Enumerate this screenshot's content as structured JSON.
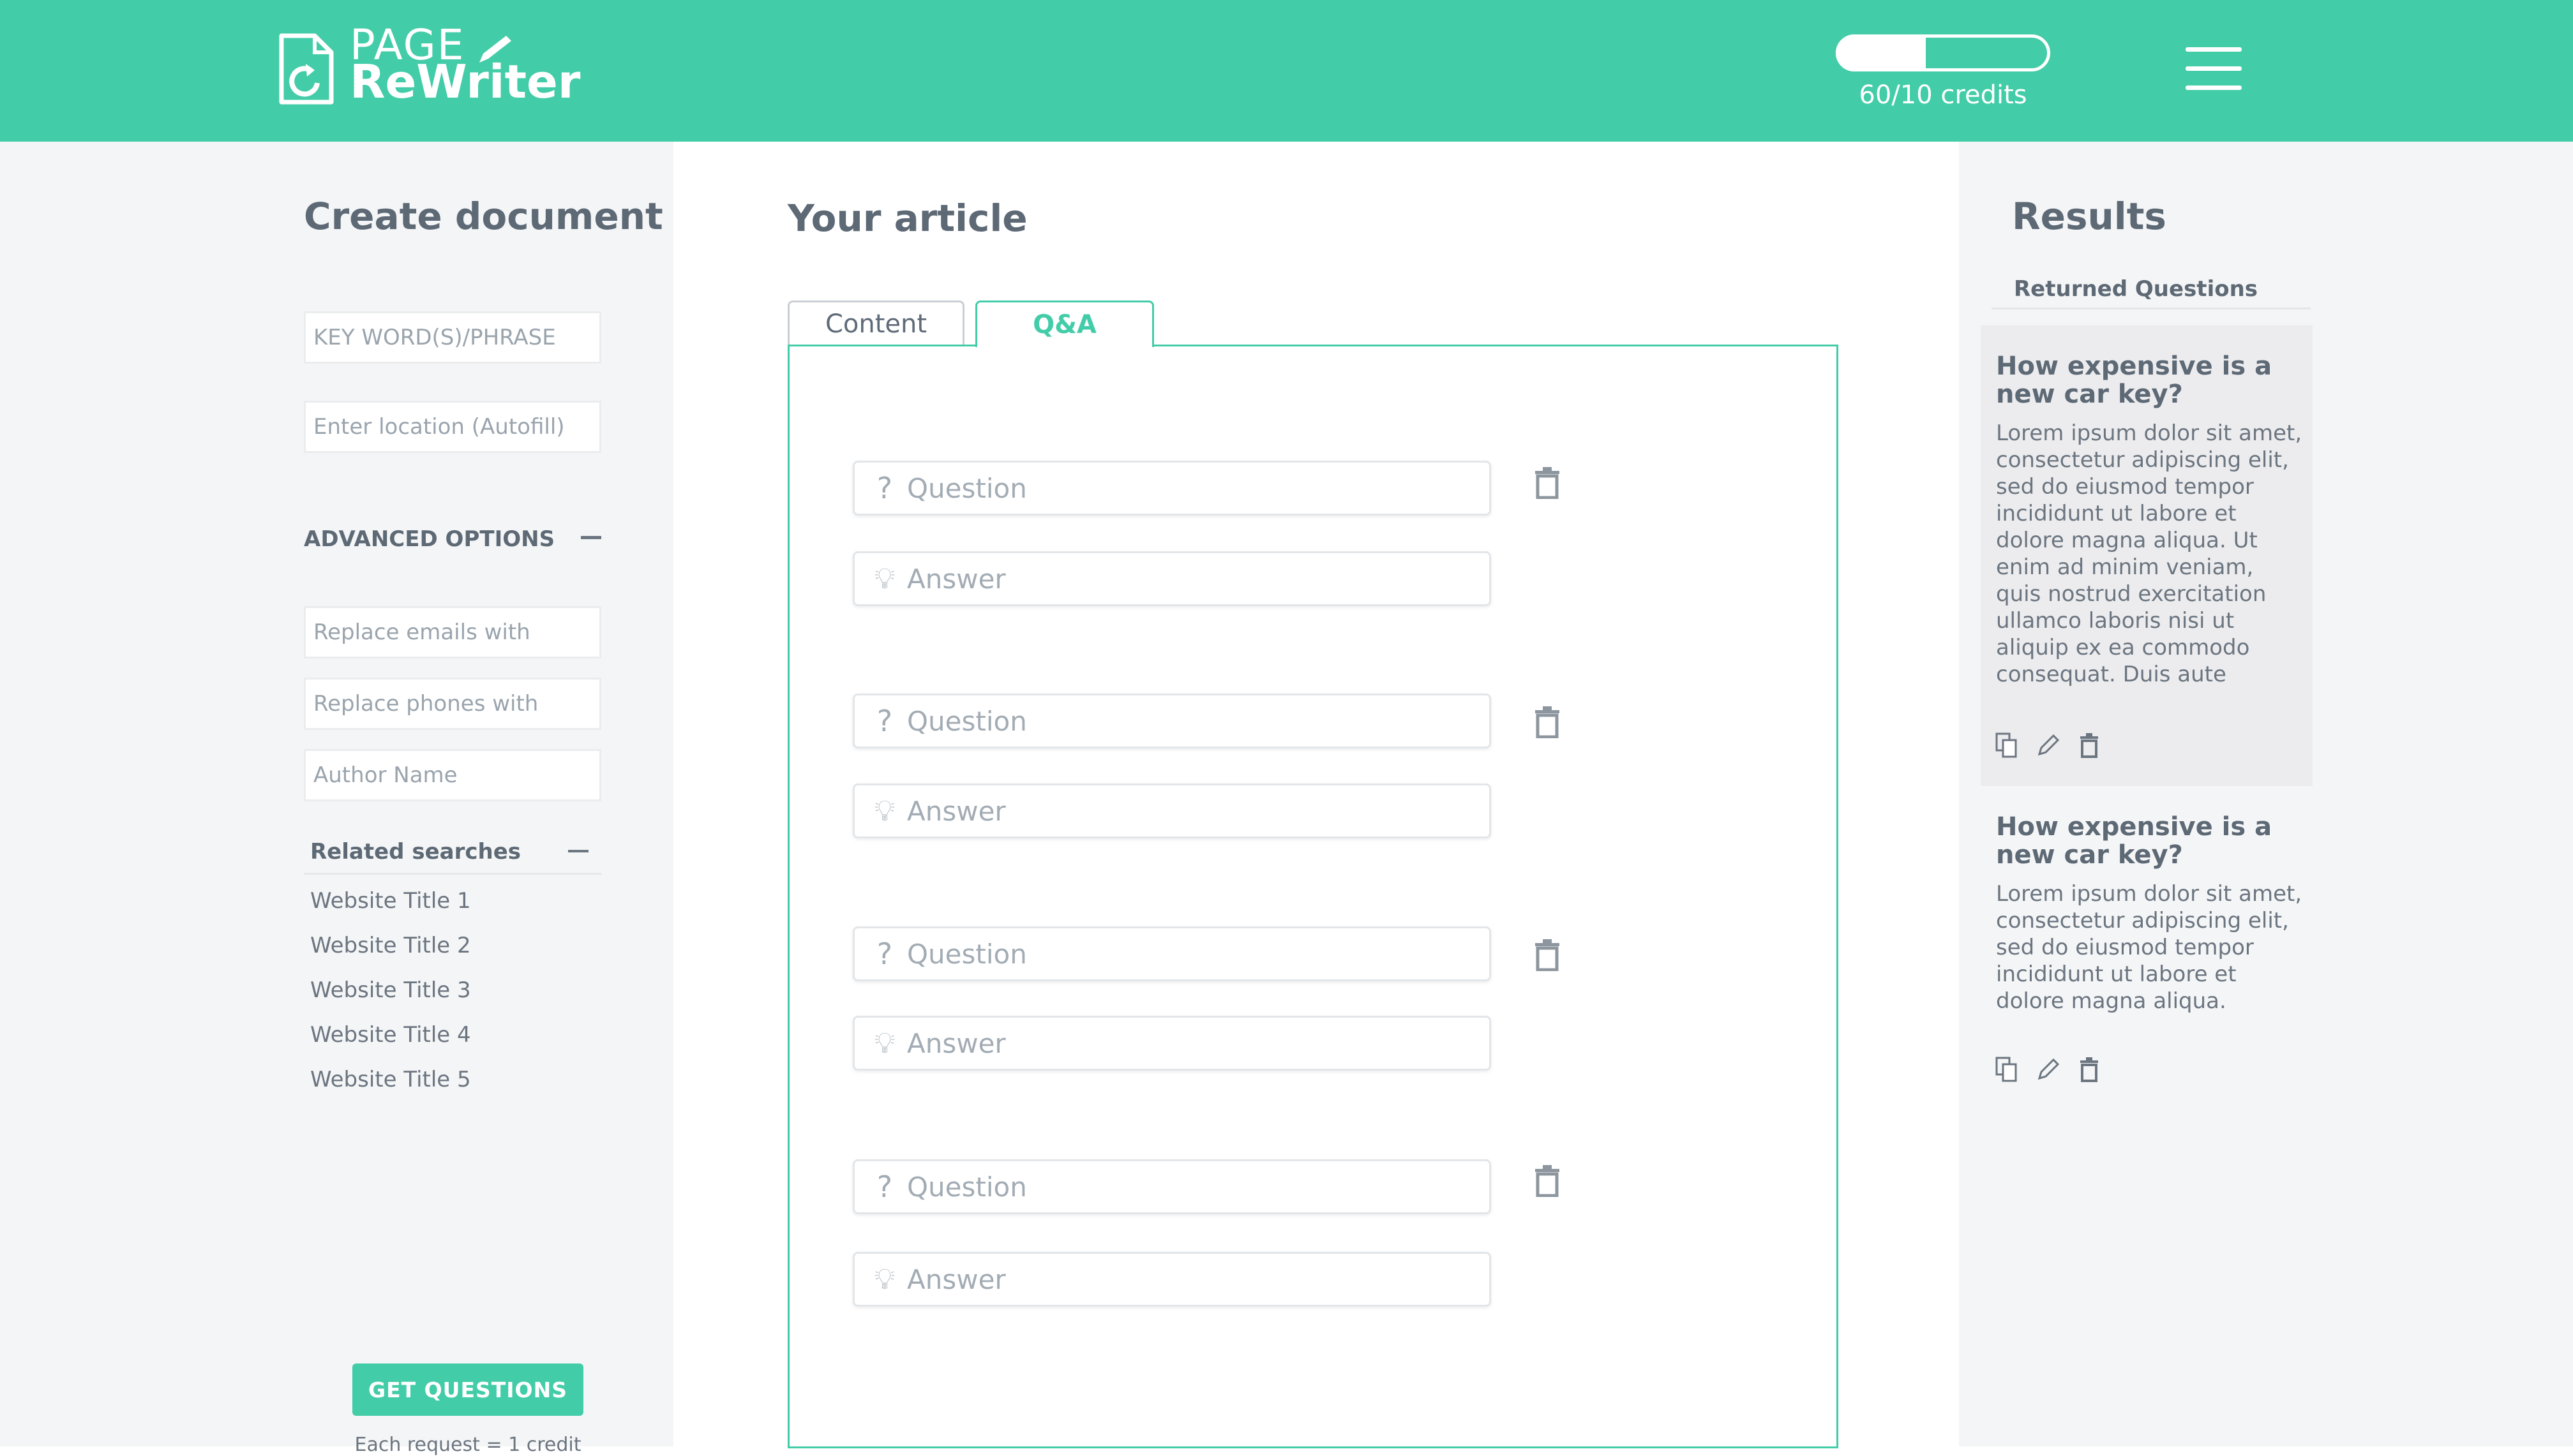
{
  "header": {
    "logo_top": "PAGE",
    "logo_bottom": "ReWriter",
    "credits_text": "60/10 credits",
    "credits_fill_fraction": 0.42,
    "menu_icon": "hamburger-menu-icon",
    "accent_color": "#43cca8"
  },
  "left": {
    "title": "Create document",
    "keyword_placeholder": "KEY WORD(S)/PHRASE",
    "location_placeholder": "Enter location (Autofill)",
    "advanced_label": "ADVANCED OPTIONS",
    "replace_emails_placeholder": "Replace emails with",
    "replace_phones_placeholder": "Replace phones with",
    "author_placeholder": "Author Name",
    "related_label": "Related searches",
    "related_items": [
      "Website Title 1",
      "Website Title 2",
      "Website Title 3",
      "Website Title 4",
      "Website Title 5"
    ],
    "get_questions_label": "GET QUESTIONS",
    "credit_note": "Each request = 1 credit"
  },
  "article": {
    "title": "Your article",
    "tabs": [
      {
        "label": "Content",
        "active": false
      },
      {
        "label": "Q&A",
        "active": true
      }
    ],
    "qa_pairs": [
      {
        "question_placeholder": "Question",
        "answer_placeholder": "Answer"
      },
      {
        "question_placeholder": "Question",
        "answer_placeholder": "Answer"
      },
      {
        "question_placeholder": "Question",
        "answer_placeholder": "Answer"
      },
      {
        "question_placeholder": "Question",
        "answer_placeholder": "Answer"
      }
    ]
  },
  "results": {
    "title": "Results",
    "subtitle": "Returned Questions",
    "cards": [
      {
        "title": "How expensive is a new car key?",
        "body": "Lorem ipsum dolor sit amet, consectetur adipiscing elit, sed do eiusmod tempor incididunt ut labore et dolore magna aliqua. Ut enim ad minim veniam, quis nostrud exercitation ullamco laboris nisi ut aliquip ex ea commodo consequat. Duis aute"
      },
      {
        "title": "How expensive is a new car key?",
        "body": "Lorem ipsum dolor sit amet, consectetur adipiscing elit, sed do eiusmod tempor incididunt ut labore et dolore magna aliqua."
      }
    ]
  }
}
